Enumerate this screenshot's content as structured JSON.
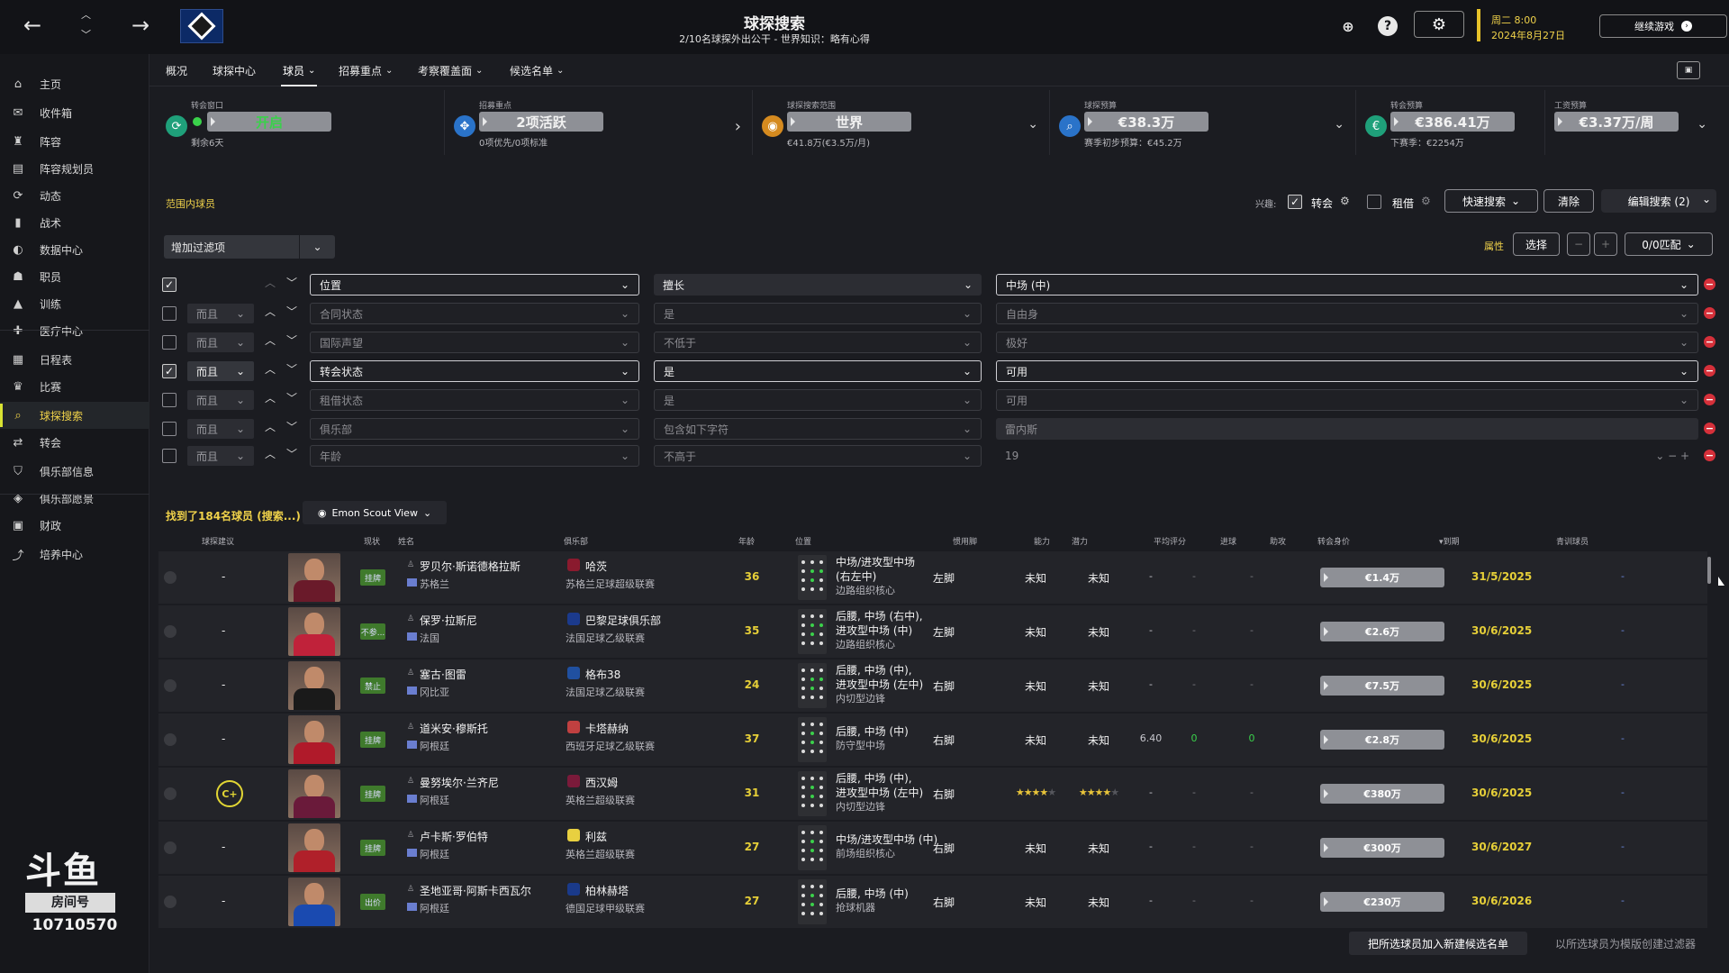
{
  "header": {
    "title": "球探搜索",
    "subtitle": "2/10名球探外出公干 - 世界知识：略有心得",
    "date_line1": "周二 8:00",
    "date_line2": "2024年8月27日",
    "continue_label": "继续游戏",
    "help_label": "?"
  },
  "sidebar": {
    "items": [
      {
        "label": "主页",
        "icon": "home-icon"
      },
      {
        "label": "收件箱",
        "icon": "inbox-icon"
      },
      {
        "label": "阵容",
        "icon": "squad-icon"
      },
      {
        "label": "阵容规划员",
        "icon": "planner-icon"
      },
      {
        "label": "动态",
        "icon": "dynamics-icon"
      },
      {
        "label": "战术",
        "icon": "tactics-icon"
      },
      {
        "label": "数据中心",
        "icon": "data-hub-icon"
      },
      {
        "label": "职员",
        "icon": "staff-icon"
      },
      {
        "label": "训练",
        "icon": "training-icon"
      },
      {
        "label": "医疗中心",
        "icon": "medical-icon"
      },
      {
        "label": "日程表",
        "icon": "calendar-icon"
      },
      {
        "label": "比赛",
        "icon": "trophy-icon"
      },
      {
        "label": "球探搜索",
        "icon": "search-icon"
      },
      {
        "label": "转会",
        "icon": "transfer-icon"
      },
      {
        "label": "俱乐部信息",
        "icon": "shield-icon"
      },
      {
        "label": "俱乐部愿景",
        "icon": "vision-icon"
      },
      {
        "label": "财政",
        "icon": "finance-icon"
      },
      {
        "label": "培养中心",
        "icon": "development-icon"
      }
    ],
    "active_index": 12
  },
  "watermark": {
    "logo": "斗鱼",
    "room": "房间号",
    "number": "10710570"
  },
  "tabs": [
    {
      "label": "概况",
      "dropdown": false
    },
    {
      "label": "球探中心",
      "dropdown": false
    },
    {
      "label": "球员",
      "dropdown": true
    },
    {
      "label": "招募重点",
      "dropdown": true
    },
    {
      "label": "考察覆盖面",
      "dropdown": true
    },
    {
      "label": "候选名单",
      "dropdown": true
    }
  ],
  "cards": [
    {
      "label": "转会窗口",
      "value": "开启",
      "sub": "剩余6天",
      "icon": "refresh-icon"
    },
    {
      "label": "招募重点",
      "value": "2项活跃",
      "sub": "0项优先/0项标准",
      "icon": "target-icon"
    },
    {
      "label": "球探搜索范围",
      "value": "世界",
      "sub": "€41.8万(€3.5万/月)",
      "icon": "globe-icon"
    },
    {
      "label": "球探预算",
      "value": "€38.3万",
      "sub": "赛季初步预算：€45.2万",
      "icon": "magnifier-icon"
    },
    {
      "label": "转会预算",
      "value": "€386.41万",
      "sub": "下赛季：€2254万",
      "icon": "money-icon"
    },
    {
      "label": "工资预算",
      "value": "€3.37万/周",
      "sub": "",
      "icon": ""
    }
  ],
  "filters": {
    "range_label": "范围内球员",
    "interest_label": "兴趣:",
    "transfer_label": "转会",
    "loan_label": "租借",
    "quick_search": "快速搜索",
    "clear": "清除",
    "edit_search": "编辑搜索 (2)",
    "add_filter": "增加过滤项",
    "attributes_label": "属性",
    "select_label": "选择",
    "minus": "−",
    "plus": "+",
    "match_label": "0/0匹配",
    "rows": [
      {
        "checked": true,
        "logic": "",
        "field": "位置",
        "op": "擅长",
        "value": "中场 (中)"
      },
      {
        "checked": false,
        "logic": "而且",
        "field": "合同状态",
        "op": "是",
        "value": "自由身"
      },
      {
        "checked": false,
        "logic": "而且",
        "field": "国际声望",
        "op": "不低于",
        "value": "极好"
      },
      {
        "checked": true,
        "logic": "而且",
        "field": "转会状态",
        "op": "是",
        "value": "可用"
      },
      {
        "checked": false,
        "logic": "而且",
        "field": "租借状态",
        "op": "是",
        "value": "可用"
      },
      {
        "checked": false,
        "logic": "而且",
        "field": "俱乐部",
        "op": "包含如下字符",
        "value": "雷内斯"
      },
      {
        "checked": false,
        "logic": "而且",
        "field": "年龄",
        "op": "不高于",
        "value": "19"
      }
    ]
  },
  "results": {
    "label": "找到了184名球员 (搜索...)",
    "view": "Emon Scout View",
    "headers": [
      "球探建议",
      "现状",
      "姓名",
      "俱乐部",
      "年龄",
      "位置",
      "惯用脚",
      "能力",
      "潜力",
      "平均评分",
      "进球",
      "助攻",
      "转会身价",
      "▾到期",
      "青训球员"
    ],
    "players": [
      {
        "rec": "-",
        "status": "挂牌",
        "name": "罗贝尔·斯诺德格拉斯",
        "nation": "苏格兰",
        "club": "哈茨",
        "league": "苏格兰足球超级联赛",
        "age": "36",
        "pos1": "中场/进攻型中场",
        "pos2": "(右左中)",
        "role": "边路组织核心",
        "foot": "左脚",
        "ability": "未知",
        "potential": "未知",
        "avg": "-",
        "goals": "-",
        "assists": "-",
        "value": "€1.4万",
        "expiry": "31/5/2025",
        "youth": "-"
      },
      {
        "rec": "-",
        "status": "不参...",
        "name": "保罗·拉斯尼",
        "nation": "法国",
        "club": "巴黎足球俱乐部",
        "league": "法国足球乙级联赛",
        "age": "35",
        "pos1": "后腰, 中场 (右中),",
        "pos2": "进攻型中场 (中)",
        "role": "边路组织核心",
        "foot": "左脚",
        "ability": "未知",
        "potential": "未知",
        "avg": "-",
        "goals": "-",
        "assists": "-",
        "value": "€2.6万",
        "expiry": "30/6/2025",
        "youth": "-"
      },
      {
        "rec": "-",
        "status": "禁止",
        "name": "塞古·图雷",
        "nation": "冈比亚",
        "club": "格布38",
        "league": "法国足球乙级联赛",
        "age": "24",
        "pos1": "后腰, 中场 (中),",
        "pos2": "进攻型中场 (左中)",
        "role": "内切型边锋",
        "foot": "右脚",
        "ability": "未知",
        "potential": "未知",
        "avg": "-",
        "goals": "-",
        "assists": "-",
        "value": "€7.5万",
        "expiry": "30/6/2025",
        "youth": "-"
      },
      {
        "rec": "-",
        "status": "挂牌",
        "name": "道米安·穆斯托",
        "nation": "阿根廷",
        "club": "卡塔赫纳",
        "league": "西班牙足球乙级联赛",
        "age": "37",
        "pos1": "后腰, 中场 (中)",
        "pos2": "",
        "role": "防守型中场",
        "foot": "右脚",
        "ability": "未知",
        "potential": "未知",
        "avg": "6.40",
        "goals": "0",
        "assists": "0",
        "value": "€2.8万",
        "expiry": "30/6/2025",
        "youth": "-"
      },
      {
        "rec": "C+",
        "status": "挂牌",
        "name": "曼努埃尔·兰齐尼",
        "nation": "阿根廷",
        "club": "西汉姆",
        "league": "英格兰超级联赛",
        "age": "31",
        "pos1": "后腰, 中场 (中),",
        "pos2": "进攻型中场 (左中)",
        "role": "内切型边锋",
        "foot": "右脚",
        "ability_stars": 3.5,
        "potential_stars": 3.5,
        "avg": "-",
        "goals": "-",
        "assists": "-",
        "value": "€380万",
        "expiry": "30/6/2025",
        "youth": "-"
      },
      {
        "rec": "-",
        "status": "挂牌",
        "name": "卢卡斯·罗伯特",
        "nation": "阿根廷",
        "club": "利兹",
        "league": "英格兰超级联赛",
        "age": "27",
        "pos1": "中场/进攻型中场 (中)",
        "pos2": "",
        "role": "前场组织核心",
        "foot": "右脚",
        "ability": "未知",
        "potential": "未知",
        "avg": "-",
        "goals": "-",
        "assists": "-",
        "value": "€300万",
        "expiry": "30/6/2027",
        "youth": "-"
      },
      {
        "rec": "-",
        "status": "出价",
        "name": "圣地亚哥·阿斯卡西瓦尔",
        "nation": "阿根廷",
        "club": "柏林赫塔",
        "league": "德国足球甲级联赛",
        "age": "27",
        "pos1": "后腰, 中场 (中)",
        "pos2": "",
        "role": "抢球机器",
        "foot": "右脚",
        "ability": "未知",
        "potential": "未知",
        "avg": "-",
        "goals": "-",
        "assists": "-",
        "value": "€230万",
        "expiry": "30/6/2026",
        "youth": "-"
      }
    ]
  },
  "footer": {
    "add_shortlist": "把所选球员加入新建候选名单",
    "create_filter": "以所选球员为模版创建过滤器"
  },
  "colors": {
    "accent_yellow": "#f0d24a",
    "remove_red": "#d6303a",
    "positive_green": "#3ad14b"
  }
}
